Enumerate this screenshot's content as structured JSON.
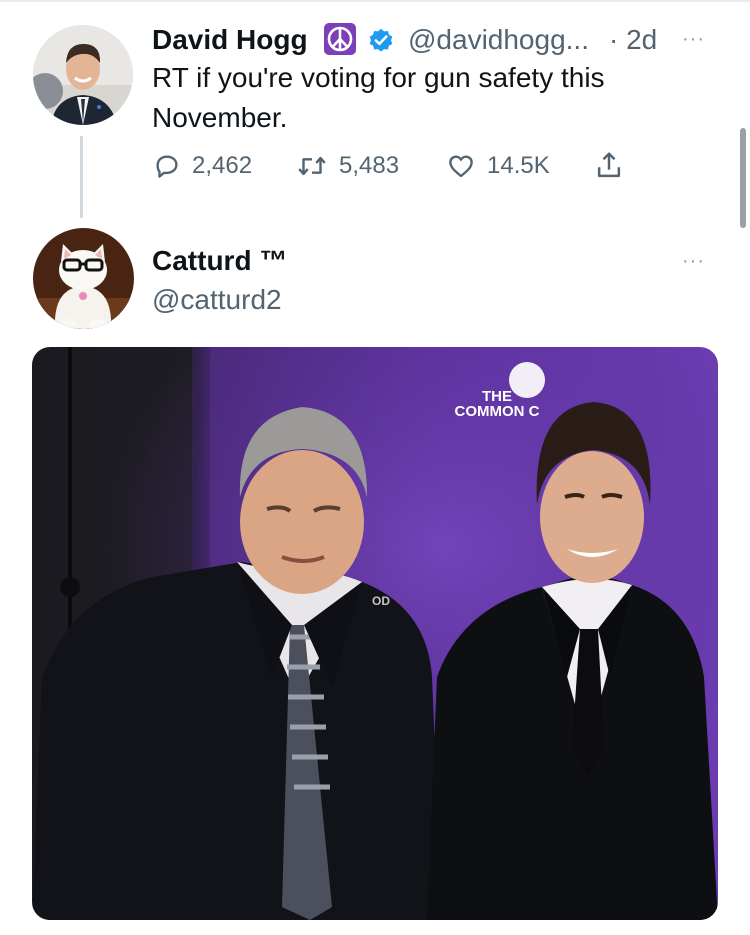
{
  "tweet1": {
    "display_name": "David Hogg",
    "handle": "@davidhogg...",
    "time": "· 2d",
    "badge_emoji": "☮",
    "text": "RT if you're voting for gun safety this November.",
    "replies": "2,462",
    "retweets": "5,483",
    "likes": "14.5K",
    "more": "···",
    "icons": [
      "reply-icon",
      "retweet-icon",
      "like-icon",
      "share-icon",
      "verified-icon",
      "peace-icon"
    ]
  },
  "tweet2": {
    "display_name": "Catturd ™",
    "handle": "@catturd2",
    "more": "···"
  },
  "media": {
    "backdrop_logo_line1": "THE",
    "backdrop_logo_line2": "COMMON C",
    "backdrop_fragment": "OD",
    "backdrop_color": "#5a2e96"
  },
  "colors": {
    "text_primary": "#0f1419",
    "text_secondary": "#536471",
    "verified": "#1d9bf0",
    "divider": "#cfd9de"
  }
}
